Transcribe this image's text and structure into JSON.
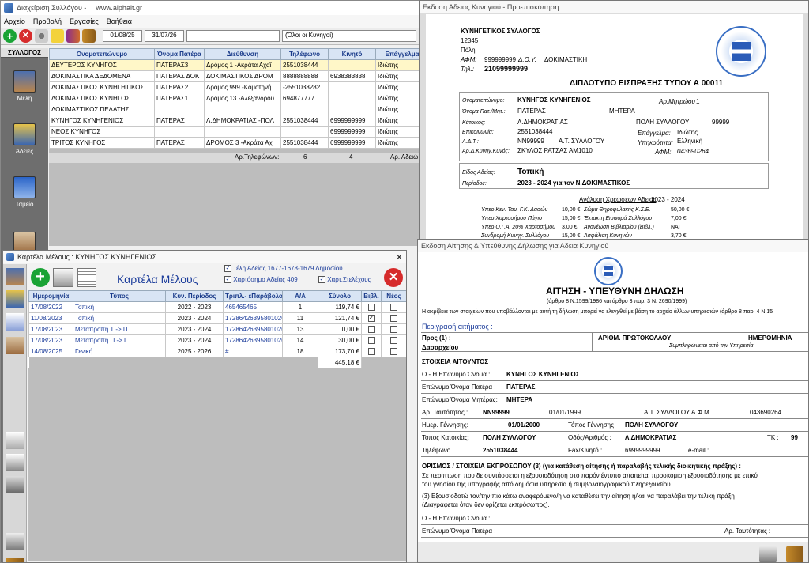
{
  "main": {
    "title": "Διαχείριση Συλλόγου -",
    "url": "www.alphait.gr",
    "menu": [
      "Αρχείο",
      "Προβολή",
      "Εργασίες",
      "Βοήθεια"
    ],
    "date_from": "01/08/25",
    "date_to": "31/07/26",
    "filter": "(Όλοι οι Κυνηγοί)",
    "sidebar_header": "ΣΥΛΛΟΓΟΣ",
    "sidebar": [
      "Μέλη",
      "Άδειες",
      "Ταμείο"
    ],
    "columns": [
      "Ονοματεπώνυμο",
      "Όνομα Πατέρα",
      "Διεύθυνση",
      "Τηλέφωνο",
      "Κινητό",
      "Επάγγελμα"
    ],
    "rows": [
      [
        "ΔΕΥΤΕΡΟΣ ΚΥΝΗΓΟΣ",
        "ΠΑΤΕΡΑΣ3",
        "Δρόμος 1 -Ακράτα Αχαΐ",
        "2551038444",
        "",
        "Ιδιώτης"
      ],
      [
        "ΔΟΚΙΜΑΣΤΙΚΑ ΔΕΔΟΜΕΝΑ",
        "ΠΑΤΕΡΑΣ ΔΟΚ",
        "ΔΟΚΙΜΑΣΤΙΚΟΣ ΔΡΟΜ",
        "8888888888",
        "6938383838",
        "Ιδιώτης"
      ],
      [
        "ΔΟΚΙΜΑΣΤΙΚΟΣ ΚΥΝΗΓΗΤΙΚΟΣ",
        "ΠΑΤΕΡΑΣ2",
        "Δρόμος 999 -Κομοτηνή",
        "-2551038282",
        "",
        "Ιδιώτης"
      ],
      [
        "ΔΟΚΙΜΑΣΤΙΚΟΣ ΚΥΝΗΓΟΣ",
        "ΠΑΤΕΡΑΣ1",
        "Δρόμος 13 -Αλεξανδρου",
        "694877777",
        "",
        "Ιδιώτης"
      ],
      [
        "ΔΟΚΙΜΑΣΤΙΚΟΣ ΠΕΛΑΤΗΣ",
        "",
        "",
        "",
        "",
        "Ιδιώτης"
      ],
      [
        "ΚΥΝΗΓΟΣ ΚΥΝΗΓΕΝΙΟΣ",
        "ΠΑΤΕΡΑΣ",
        "Λ.ΔΗΜΟΚΡΑΤΙΑΣ -ΠΟΛ",
        "2551038444",
        "6999999999",
        "Ιδιώτης"
      ],
      [
        "ΝΕΟΣ ΚΥΝΗΓΟΣ",
        "",
        "",
        "",
        "6999999999",
        "Ιδιώτης"
      ],
      [
        "ΤΡΙΤΟΣ ΚΥΝΗΓΟΣ",
        "ΠΑΤΕΡΑΣ",
        "ΔΡΟΜΟΣ 3 -Ακράτα Αχ",
        "2551038444",
        "6999999999",
        "Ιδιώτης"
      ]
    ],
    "footer_label": "Αρ.Τηλεφώνων:",
    "footer_phones": "6",
    "footer_mobiles": "4",
    "footer_more": "Αρ. Αδειώ"
  },
  "card": {
    "title": "Καρτέλα Μέλους : ΚΥΝΗΓΟΣ ΚΥΝΗΓΕΝΙΟΣ",
    "heading": "Καρτέλα Μέλους",
    "checks": [
      "Τέλη Αδείας 1677-1678-1679 Δημοσίου",
      "Χαρτόσημο Αδείας 409",
      "Χαρτ.Στελέχους"
    ],
    "columns": [
      "Ημερομηνία",
      "Τύπος",
      "Κυν. Περίοδος",
      "Τριπλ.- εΠαράβολο",
      "Α/Α",
      "Σύνολο",
      "Βιβλ.",
      "Νέος"
    ],
    "rows": [
      [
        "17/08/2022",
        "Τοπική",
        "2022 - 2023",
        "465465465",
        "1",
        "119,74 €",
        "",
        ""
      ],
      [
        "11/08/2023",
        "Τοπική",
        "2023 - 2024",
        "172864263958010200",
        "11",
        "121,74 €",
        "✓",
        ""
      ],
      [
        "17/08/2023",
        "Μεταπροπή Τ -> Π",
        "2023 - 2024",
        "172864263958010200",
        "13",
        "0,00 €",
        "",
        ""
      ],
      [
        "17/08/2023",
        "Μεταπροπή Π -> Γ",
        "2023 - 2024",
        "172864263958010200",
        "14",
        "30,00 €",
        "",
        ""
      ],
      [
        "14/08/2025",
        "Γενική",
        "2025 - 2026",
        "#",
        "18",
        "173,70 €",
        "",
        ""
      ]
    ],
    "total": "445,18 €"
  },
  "receipt": {
    "title": "Εκδοση Αδειας Κυνηγιού - Προεπισκόπηση",
    "club": "ΚΥΝΗΓΕΤΙΚΟΣ ΣΥΛΛΟΓΟΣ",
    "zip": "12345",
    "city": "Πόλη",
    "afm_label": "ΑΦΜ:",
    "afm": "999999999",
    "doy_label": "Δ.Ο.Υ.",
    "doy": "ΔΟΚΙΜΑΣΤΙΚΗ",
    "tel_label": "Τηλ.:",
    "tel": "21099999999",
    "doc_title": "ΔΙΠΛΟΤΥΠΟ ΕΙΣΠΡΑΞΗΣ ΤΥΠΟΥ Α 00011",
    "labels": {
      "name": "Ονοματεπώνυμο:",
      "father": "Όνομα Πατ./Μητ.:",
      "home": "Κάτοικος:",
      "contact": "Επικοινωνία:",
      "adt": "Α.Δ.Τ.:",
      "card": "Αρ.Δ.Κυνηγ.Κυνός:",
      "reg": "Αρ.Μητρώου",
      "job": "Επάγγελμα:",
      "citizen": "Υπηκοότητα:",
      "afm2": "ΑΦΜ:"
    },
    "values": {
      "name": "ΚΥΝΗΓΟΣ ΚΥΝΗΓΕΝΙΟΣ",
      "father": "ΠΑΤΕΡΑΣ",
      "mother": "ΜΗΤΕΡΑ",
      "home": "Λ.ΔΗΜΟΚΡΑΤΙΑΣ",
      "city": "ΠΟΛΗ ΣΥΛΛΟΓΟΥ",
      "zip": "99999",
      "contact": "2551038444",
      "job": "Ιδιώτης",
      "adt": "ΝΝ99999",
      "adt_issuer": "Α.Τ. ΣΥΛΛΟΓΟΥ",
      "citizen": "Ελληνική",
      "card": "ΣΚΥΛΟΣ ΡΑΤΣΑΣ ΑΜ1010",
      "afm2": "043690264",
      "reg": "1"
    },
    "type_label": "Είδος Αδείας:",
    "type": "Τοπική",
    "period_label": "Περίοδος:",
    "period": "2023 - 2024 για τον Ν.ΔΟΚΙΜΑΣΤΙΚΟΣ",
    "analysis_label": "Ανάλυση Χρεώσεων Άδειας",
    "analysis_period": "2023 - 2024",
    "charges": [
      [
        "Υπερ Κεν. Ταμ. Γ.Κ. Δασών",
        "10,00 €",
        "Σώμα Θηροφυλακής Κ.Σ.Ε.",
        "50,00 €"
      ],
      [
        "Υπερ Χαρτοσήμου Πάγιο",
        "15,00 €",
        "Έκτακτη Εισφορά Συλλόγου",
        "7,00 €"
      ],
      [
        "Υπερ Ο.Γ.Α. 20% Χαρτοσήμου",
        "3,00 €",
        "Ανανέωση Βιβλιαρίου (Βιβλ.)",
        "ΝΑΙ"
      ],
      [
        "Συνδρομή Κυνηγ. Συλλόγου",
        "15,00 €",
        "Ασφάλιση Κυνηγών",
        "3,70 €"
      ]
    ]
  },
  "app": {
    "title": "Εκδοση Αίτησης & Υπεύθυνης Δήλωσης για Αδεια Κυνηγιού",
    "heading": "ΑΙΤΗΣΗ - ΥΠΕΥΘΥΝΗ ΔΗΛΩΣΗ",
    "subheading": "(άρθρο 8 Ν.1599/1986 και άρθρο 3 παρ. 3 Ν. 2690/1999)",
    "note": "Η ακρίβεια των στοιχείων που υποβάλλονται με αυτή τη δήλωση μπορεί να ελεγχθεί με βάση το αρχείο άλλων υπηρεσιών (άρθρο 8 παρ. 4 Ν.15",
    "desc": "Περιγραφή αιτήματος :",
    "to": "Προς (1) :",
    "to_val": "Δασαρχείου",
    "protocol": "ΑΡΙΘΜ. ΠΡΩΤΟΚΟΛΛΟΥ",
    "date": "ΗΜΕΡΟΜΗΝΙΑ",
    "fill": "Συμπληρώνεται από την Υπηρεσία",
    "section": "ΣΤΟΙΧΕΙΑ ΑΙΤΟΥΝΤΟΣ",
    "name_l": "Ο - Η Επώνυμο Όνομα :",
    "name_v": "ΚΥΝΗΓΟΣ ΚΥΝΗΓΕΝΙΟΣ",
    "father_l": "Επώνυμο Όνομα Πατέρα :",
    "father_v": "ΠΑΤΕΡΑΣ",
    "mother_l": "Επώνυμο Όνομα Μητέρας:",
    "mother_v": "ΜΗΤΕΡΑ",
    "id_l": "Αρ. Ταυτότητας :",
    "id_v": "ΝΝ99999",
    "id_date": "01/01/1999",
    "id_issuer": "Α.Τ. ΣΥΛΛΟΓΟΥ",
    "afm_l": "Α.Φ.Μ",
    "afm_v": "043690264",
    "birth_l": "Ημερ. Γέννησης:",
    "birth_v": "01/01/2000",
    "bplace_l": "Τόπος Γέννησης",
    "bplace_v": "ΠΟΛΗ ΣΥΛΛΟΓΟΥ",
    "home_l": "Τόπος Κατοικίας:",
    "home_v": "ΠΟΛΗ ΣΥΛΛΟΓΟΥ",
    "street_l": "Οδός/Αριθμός :",
    "street_v": "Λ.ΔΗΜΟΚΡΑΤΙΑΣ",
    "tk_l": "ΤΚ :",
    "tk_v": "99",
    "phone_l": "Τηλέφωνο :",
    "phone_v": "2551038444",
    "fax_l": "Fax/Κινητό :",
    "fax_v": "6999999999",
    "email_l": "e-mail :",
    "rep_title": "ΟΡΙΣΜΟΣ / ΣΤΟΙΧΕΙΑ ΕΚΠΡΟΣΩΠΟΥ (3) (για κατάθεση αίτησης ή παραλαβής τελικής διοικητικής πράξης) :",
    "rep_p1": "Σε περίπτωση που δε συντάσσεται η εξουσιοδότηση στο παρόν έντυπο απαιτείται προσκόμιση εξουσιοδότησης με επικύ",
    "rep_p2": "του γνησίου της υπογραφής από δημόσια υπηρεσία ή συμβολαιογραφικού πληρεξουσίου.",
    "rep_p3": "(3) Εξουσιοδοτώ τον/την πιο κάτω αναφερόμενο/η να καταθέσει την αίτηση ή/και να παραλάβει την τελική πράξη",
    "rep_p4": "(Διαγράφεται όταν δεν ορίζεται εκπρόσωπος).",
    "rep_name": "Ο - Η Επώνυμο Όνομα :",
    "rep_father": "Επώνυμο Όνομα Πατέρα :",
    "rep_id": "Αρ. Ταυτότητας :"
  }
}
